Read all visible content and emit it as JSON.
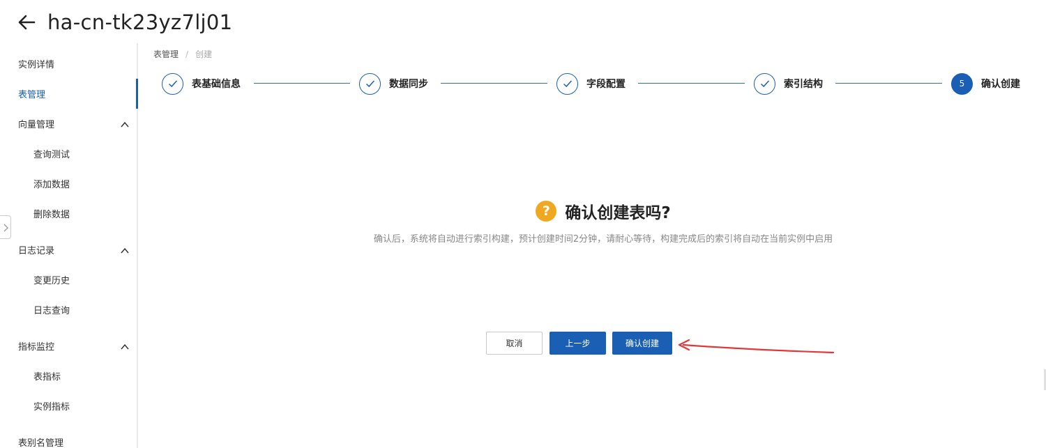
{
  "header": {
    "title": "ha-cn-tk23yz7lj01"
  },
  "sidebar": {
    "items": [
      {
        "label": "实例详情"
      },
      {
        "label": "表管理"
      },
      {
        "label": "向量管理"
      },
      {
        "label": "查询测试"
      },
      {
        "label": "添加数据"
      },
      {
        "label": "删除数据"
      },
      {
        "label": "日志记录"
      },
      {
        "label": "变更历史"
      },
      {
        "label": "日志查询"
      },
      {
        "label": "指标监控"
      },
      {
        "label": "表指标"
      },
      {
        "label": "实例指标"
      },
      {
        "label": "表别名管理"
      }
    ]
  },
  "breadcrumb": {
    "parent": "表管理",
    "separator": "/",
    "current": "创建"
  },
  "steps": [
    {
      "label": "表基础信息",
      "status": "done"
    },
    {
      "label": "数据同步",
      "status": "done"
    },
    {
      "label": "字段配置",
      "status": "done"
    },
    {
      "label": "索引结构",
      "status": "done"
    },
    {
      "label": "确认创建",
      "status": "current",
      "number": "5"
    }
  ],
  "confirm": {
    "icon_text": "?",
    "title": "确认创建表吗?",
    "description": "确认后，系统将自动进行索引构建，预计创建时间2分钟，请耐心等待，构建完成后的索引将自动在当前实例中启用"
  },
  "buttons": {
    "cancel": "取消",
    "prev": "上一步",
    "confirm": "确认创建"
  },
  "colors": {
    "primary": "#1a5fb4",
    "warning": "#f0a820",
    "annotation": "#e0383a"
  }
}
